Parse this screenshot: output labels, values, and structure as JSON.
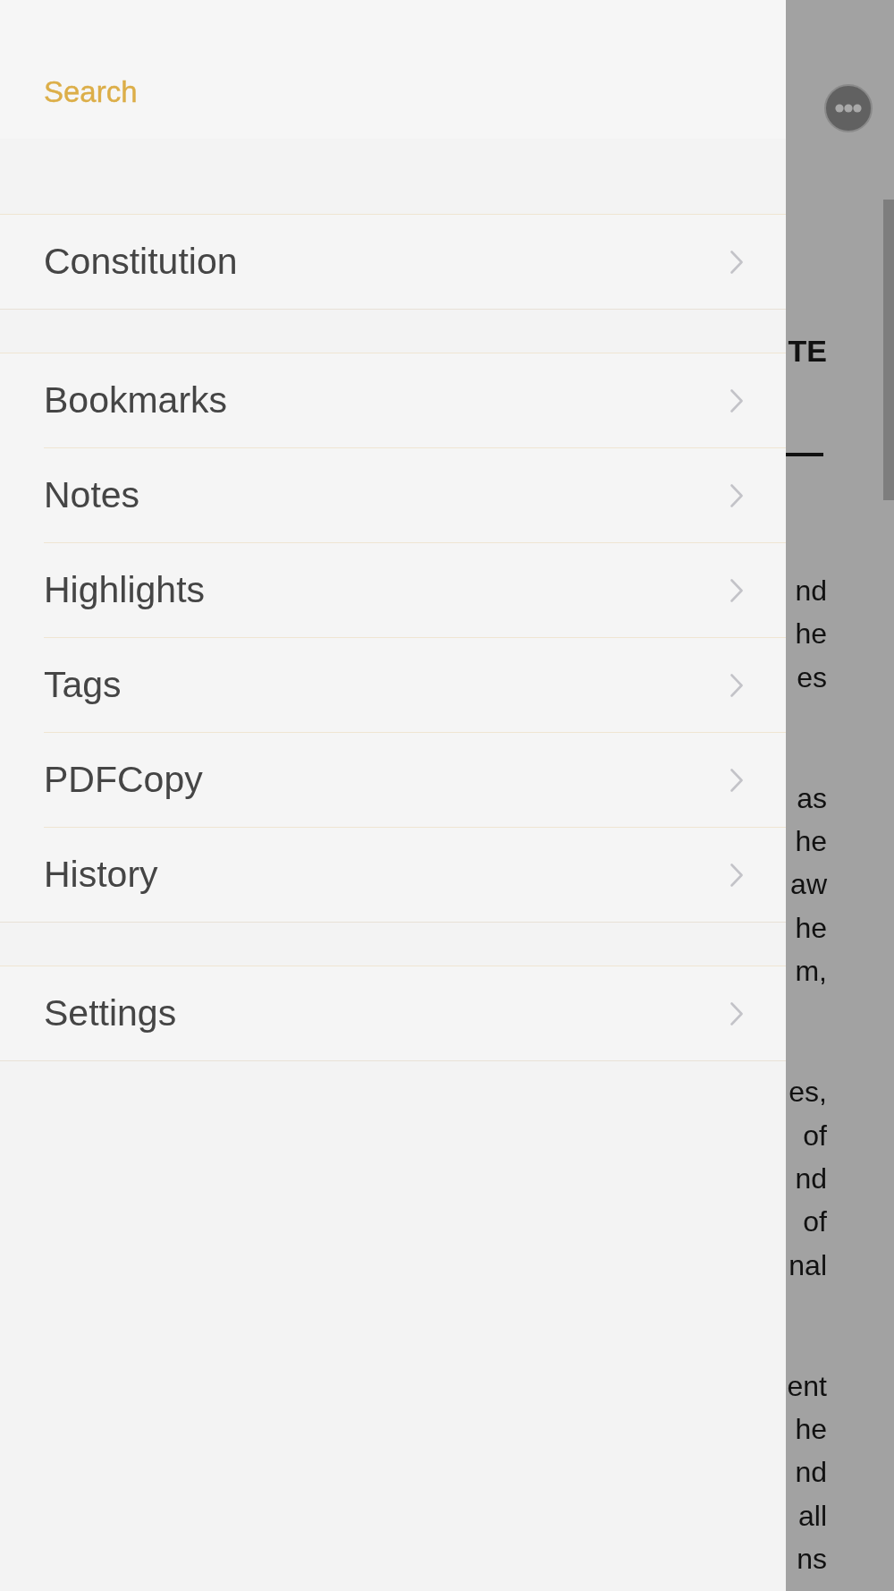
{
  "drawer": {
    "search_label": "Search",
    "sections": [
      {
        "items": [
          {
            "label": "Constitution"
          }
        ]
      },
      {
        "items": [
          {
            "label": "Bookmarks"
          },
          {
            "label": "Notes"
          },
          {
            "label": "Highlights"
          },
          {
            "label": "Tags"
          },
          {
            "label": "PDFCopy"
          },
          {
            "label": "History"
          }
        ]
      },
      {
        "items": [
          {
            "label": "Settings"
          }
        ]
      }
    ]
  },
  "document": {
    "heading": "TE",
    "paragraphs": [
      [
        "nd",
        "he",
        "es"
      ],
      [
        "as",
        "he",
        "aw",
        "he",
        "m,"
      ],
      [
        "es,",
        "of",
        "nd",
        "of",
        "nal"
      ],
      [
        "ent",
        "he",
        "nd",
        "all",
        "ns"
      ]
    ]
  }
}
